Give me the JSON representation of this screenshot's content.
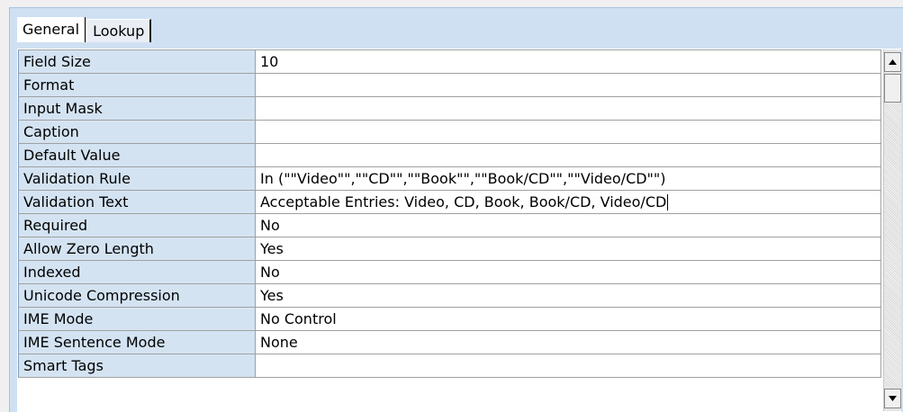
{
  "tabs": [
    {
      "label": "General",
      "active": true
    },
    {
      "label": "Lookup",
      "active": false
    }
  ],
  "properties": [
    {
      "name": "Field Size",
      "value": "10"
    },
    {
      "name": "Format",
      "value": ""
    },
    {
      "name": "Input Mask",
      "value": ""
    },
    {
      "name": "Caption",
      "value": ""
    },
    {
      "name": "Default Value",
      "value": ""
    },
    {
      "name": "Validation Rule",
      "value": "In (\"\"Video\"\",\"\"CD\"\",\"\"Book\"\",\"\"Book/CD\"\",\"\"Video/CD\"\")"
    },
    {
      "name": "Validation Text",
      "value": "Acceptable Entries: Video, CD, Book, Book/CD, Video/CD",
      "focused": true
    },
    {
      "name": "Required",
      "value": "No"
    },
    {
      "name": "Allow Zero Length",
      "value": "Yes"
    },
    {
      "name": "Indexed",
      "value": "No"
    },
    {
      "name": "Unicode Compression",
      "value": "Yes"
    },
    {
      "name": "IME Mode",
      "value": "No Control"
    },
    {
      "name": "IME Sentence Mode",
      "value": "None"
    },
    {
      "name": "Smart Tags",
      "value": ""
    }
  ],
  "scrollbar": {
    "up_icon": "scroll-up-arrow-icon",
    "down_icon": "scroll-down-arrow-icon"
  },
  "colors": {
    "frame": "#cfe0f3",
    "name_cell": "#d4e3f2",
    "value_cell": "#ffffff"
  }
}
